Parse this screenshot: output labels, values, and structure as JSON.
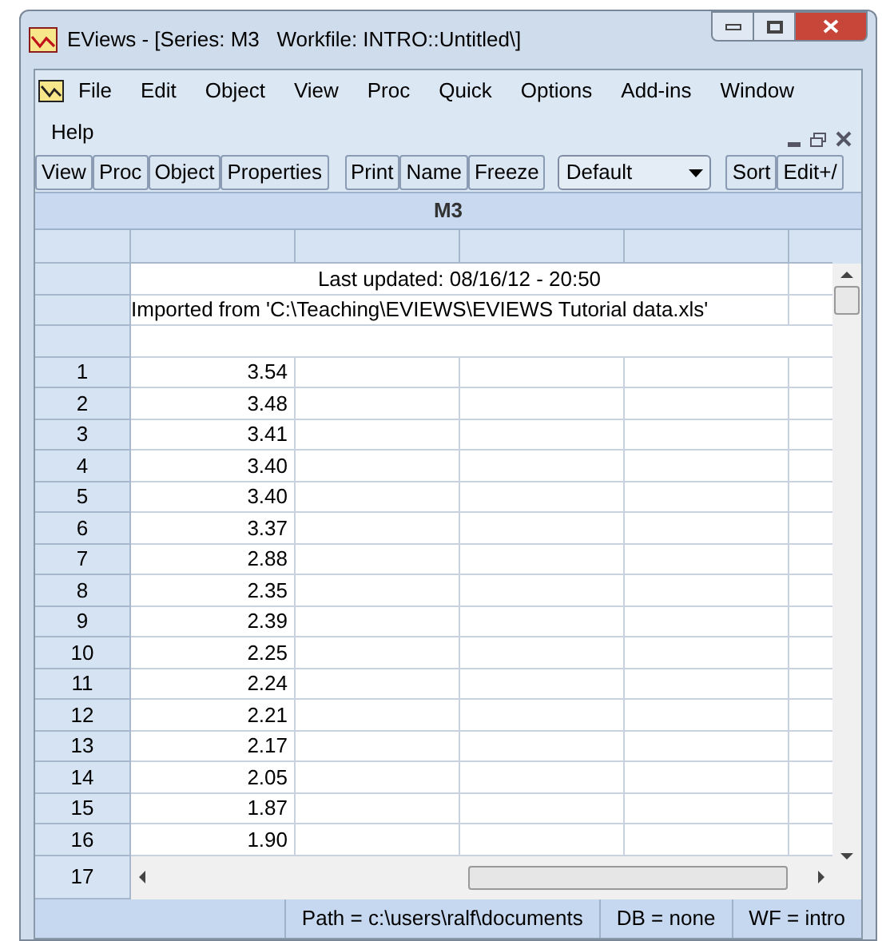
{
  "window": {
    "title": "EViews - [Series: M3   Workfile: INTRO::Untitled\\]"
  },
  "menu": [
    "File",
    "Edit",
    "Object",
    "View",
    "Proc",
    "Quick",
    "Options",
    "Add-ins",
    "Window"
  ],
  "menu_second_row": [
    "Help"
  ],
  "toolbar": {
    "buttons_object": [
      "View",
      "Proc",
      "Object",
      "Properties"
    ],
    "buttons_output": [
      "Print",
      "Name",
      "Freeze"
    ],
    "dropdown": "Default",
    "buttons_right": [
      "Sort",
      "Edit+/"
    ]
  },
  "grid": {
    "title": "M3",
    "notes": [
      "Last updated: 08/16/12 - 20:50",
      "Imported from 'C:\\Teaching\\EVIEWS\\EVIEWS Tutorial data.xls'"
    ],
    "rows": [
      {
        "label": "1",
        "value": "3.54"
      },
      {
        "label": "2",
        "value": "3.48"
      },
      {
        "label": "3",
        "value": "3.41"
      },
      {
        "label": "4",
        "value": "3.40"
      },
      {
        "label": "5",
        "value": "3.40"
      },
      {
        "label": "6",
        "value": "3.37"
      },
      {
        "label": "7",
        "value": "2.88"
      },
      {
        "label": "8",
        "value": "2.35"
      },
      {
        "label": "9",
        "value": "2.39"
      },
      {
        "label": "10",
        "value": "2.25"
      },
      {
        "label": "11",
        "value": "2.24"
      },
      {
        "label": "12",
        "value": "2.21"
      },
      {
        "label": "13",
        "value": "2.17"
      },
      {
        "label": "14",
        "value": "2.05"
      },
      {
        "label": "15",
        "value": "1.87"
      },
      {
        "label": "16",
        "value": "1.90"
      }
    ],
    "last_row_label": "17"
  },
  "status_bar": [
    "Path = c:\\users\\ralf\\documents",
    "DB = none",
    "WF = intro"
  ]
}
